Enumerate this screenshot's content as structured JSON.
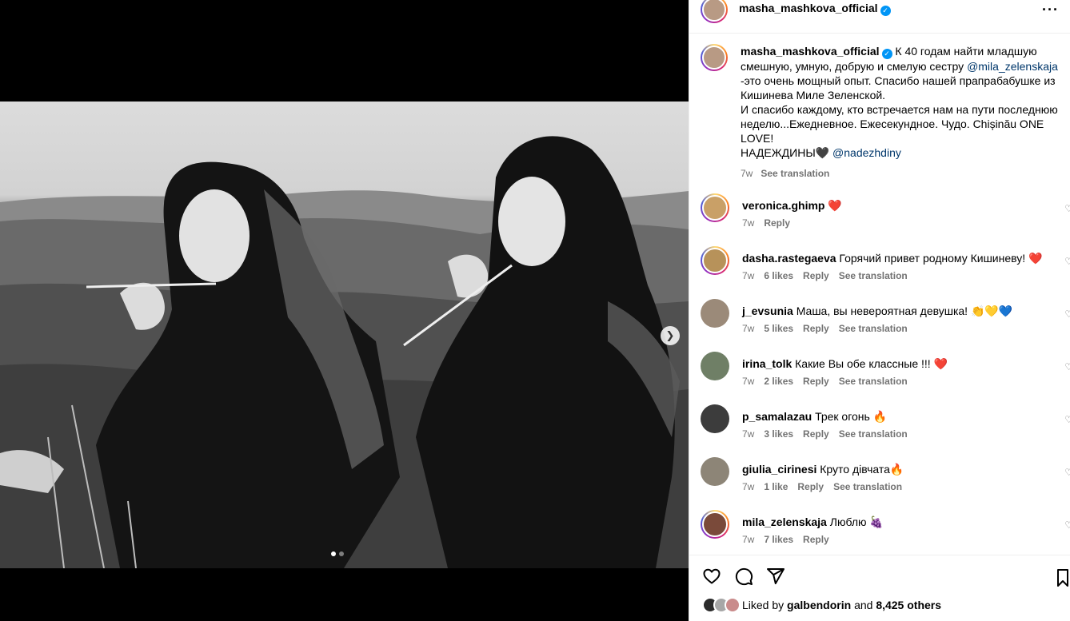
{
  "post": {
    "author": "masha_mashkova_official",
    "caption_lines": [
      "К 40 годам найти младшую",
      "смешную, умную, добрую и смелую сестру",
      "-это очень мощный опыт. Спасибо нашей прапрабабушке из",
      "Кишинева Миле Зеленской.",
      "И спасибо каждому, кто встречается нам на пути последнюю",
      "неделю...Ежедневное. Ежесекундное. Чудо. Chișinău ONE",
      "LOVE!",
      "НАДЕЖДИНЫ🖤"
    ],
    "caption_mention_1": "@mila_zelenskaja",
    "caption_mention_2": "@nadezhdiny",
    "time": "7w",
    "see_translation": "See translation",
    "more_icon": "more-dots-icon"
  },
  "comments": [
    {
      "user": "veronica.ghimp",
      "text": "❤️",
      "time": "7w",
      "likes": "",
      "reply": "Reply",
      "translate": "",
      "avatar": "#c9a067",
      "ring": true
    },
    {
      "user": "dasha.rastegaeva",
      "text": "Горячий привет родному Кишиневу! ❤️",
      "time": "7w",
      "likes": "6 likes",
      "reply": "Reply",
      "translate": "See translation",
      "avatar": "#b7925a",
      "ring": true
    },
    {
      "user": "j_evsunia",
      "text": "Маша, вы невероятная девушка! 👏💛💙",
      "time": "7w",
      "likes": "5 likes",
      "reply": "Reply",
      "translate": "See translation",
      "avatar": "#9b8a79",
      "ring": false
    },
    {
      "user": "irina_tolk",
      "text": "Какие Вы обе классные !!! ❤️",
      "time": "7w",
      "likes": "2 likes",
      "reply": "Reply",
      "translate": "See translation",
      "avatar": "#6f7f66",
      "ring": false
    },
    {
      "user": "p_samalazau",
      "text": "Трек огонь 🔥",
      "time": "7w",
      "likes": "3 likes",
      "reply": "Reply",
      "translate": "See translation",
      "avatar": "#3c3c3c",
      "ring": false
    },
    {
      "user": "giulia_cirinesi",
      "text": "Круто дівчата🔥",
      "time": "7w",
      "likes": "1 like",
      "reply": "Reply",
      "translate": "See translation",
      "avatar": "#8d8577",
      "ring": false
    },
    {
      "user": "mila_zelenskaja",
      "text": "Люблю 🍇",
      "time": "7w",
      "likes": "7 likes",
      "reply": "Reply",
      "translate": "",
      "avatar": "#7a4a3a",
      "ring": true
    }
  ],
  "likes": {
    "prefix": "Liked by",
    "user": "galbendorin",
    "and": "and",
    "others": "8,425 others"
  },
  "carousel": {
    "slides": 2,
    "current": 1,
    "next_icon": "chevron-right-icon"
  },
  "colors": {
    "accent": "#0095f6",
    "mention": "#00376b",
    "muted": "#737373"
  }
}
